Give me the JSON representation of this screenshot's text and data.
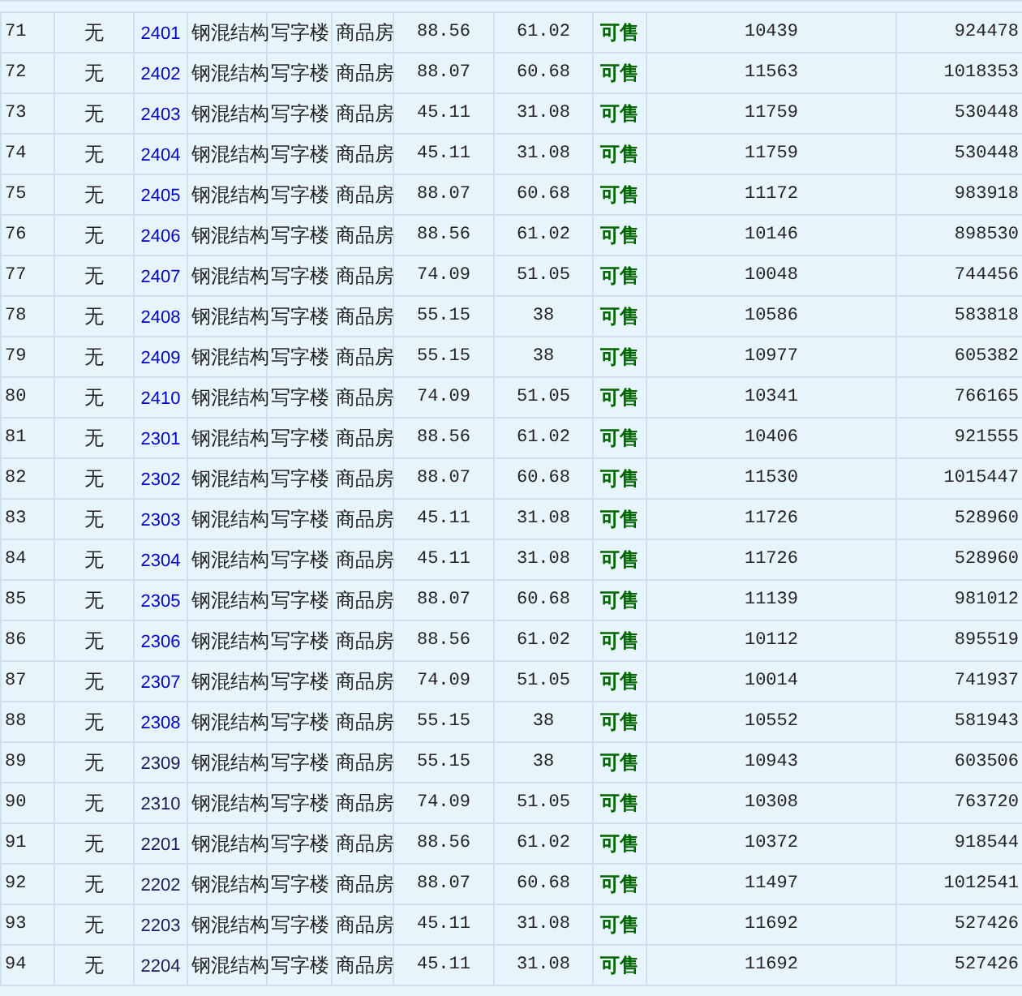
{
  "rows": [
    {
      "number": "71",
      "column_2": "无",
      "room": "2401",
      "visited": false,
      "structure": "钢混结构",
      "usage": "写字楼",
      "property_type": "商品房",
      "column_7": "88.56",
      "column_8": "61.02",
      "status": "可售",
      "column_10": "10439",
      "column_11": "924478"
    },
    {
      "number": "72",
      "column_2": "无",
      "room": "2402",
      "visited": false,
      "structure": "钢混结构",
      "usage": "写字楼",
      "property_type": "商品房",
      "column_7": "88.07",
      "column_8": "60.68",
      "status": "可售",
      "column_10": "11563",
      "column_11": "1018353"
    },
    {
      "number": "73",
      "column_2": "无",
      "room": "2403",
      "visited": false,
      "structure": "钢混结构",
      "usage": "写字楼",
      "property_type": "商品房",
      "column_7": "45.11",
      "column_8": "31.08",
      "status": "可售",
      "column_10": "11759",
      "column_11": "530448"
    },
    {
      "number": "74",
      "column_2": "无",
      "room": "2404",
      "visited": false,
      "structure": "钢混结构",
      "usage": "写字楼",
      "property_type": "商品房",
      "column_7": "45.11",
      "column_8": "31.08",
      "status": "可售",
      "column_10": "11759",
      "column_11": "530448"
    },
    {
      "number": "75",
      "column_2": "无",
      "room": "2405",
      "visited": false,
      "structure": "钢混结构",
      "usage": "写字楼",
      "property_type": "商品房",
      "column_7": "88.07",
      "column_8": "60.68",
      "status": "可售",
      "column_10": "11172",
      "column_11": "983918"
    },
    {
      "number": "76",
      "column_2": "无",
      "room": "2406",
      "visited": false,
      "structure": "钢混结构",
      "usage": "写字楼",
      "property_type": "商品房",
      "column_7": "88.56",
      "column_8": "61.02",
      "status": "可售",
      "column_10": "10146",
      "column_11": "898530"
    },
    {
      "number": "77",
      "column_2": "无",
      "room": "2407",
      "visited": false,
      "structure": "钢混结构",
      "usage": "写字楼",
      "property_type": "商品房",
      "column_7": "74.09",
      "column_8": "51.05",
      "status": "可售",
      "column_10": "10048",
      "column_11": "744456"
    },
    {
      "number": "78",
      "column_2": "无",
      "room": "2408",
      "visited": false,
      "structure": "钢混结构",
      "usage": "写字楼",
      "property_type": "商品房",
      "column_7": "55.15",
      "column_8": "38",
      "status": "可售",
      "column_10": "10586",
      "column_11": "583818"
    },
    {
      "number": "79",
      "column_2": "无",
      "room": "2409",
      "visited": false,
      "structure": "钢混结构",
      "usage": "写字楼",
      "property_type": "商品房",
      "column_7": "55.15",
      "column_8": "38",
      "status": "可售",
      "column_10": "10977",
      "column_11": "605382"
    },
    {
      "number": "80",
      "column_2": "无",
      "room": "2410",
      "visited": false,
      "structure": "钢混结构",
      "usage": "写字楼",
      "property_type": "商品房",
      "column_7": "74.09",
      "column_8": "51.05",
      "status": "可售",
      "column_10": "10341",
      "column_11": "766165"
    },
    {
      "number": "81",
      "column_2": "无",
      "room": "2301",
      "visited": false,
      "structure": "钢混结构",
      "usage": "写字楼",
      "property_type": "商品房",
      "column_7": "88.56",
      "column_8": "61.02",
      "status": "可售",
      "column_10": "10406",
      "column_11": "921555"
    },
    {
      "number": "82",
      "column_2": "无",
      "room": "2302",
      "visited": false,
      "structure": "钢混结构",
      "usage": "写字楼",
      "property_type": "商品房",
      "column_7": "88.07",
      "column_8": "60.68",
      "status": "可售",
      "column_10": "11530",
      "column_11": "1015447"
    },
    {
      "number": "83",
      "column_2": "无",
      "room": "2303",
      "visited": false,
      "structure": "钢混结构",
      "usage": "写字楼",
      "property_type": "商品房",
      "column_7": "45.11",
      "column_8": "31.08",
      "status": "可售",
      "column_10": "11726",
      "column_11": "528960"
    },
    {
      "number": "84",
      "column_2": "无",
      "room": "2304",
      "visited": false,
      "structure": "钢混结构",
      "usage": "写字楼",
      "property_type": "商品房",
      "column_7": "45.11",
      "column_8": "31.08",
      "status": "可售",
      "column_10": "11726",
      "column_11": "528960"
    },
    {
      "number": "85",
      "column_2": "无",
      "room": "2305",
      "visited": false,
      "structure": "钢混结构",
      "usage": "写字楼",
      "property_type": "商品房",
      "column_7": "88.07",
      "column_8": "60.68",
      "status": "可售",
      "column_10": "11139",
      "column_11": "981012"
    },
    {
      "number": "86",
      "column_2": "无",
      "room": "2306",
      "visited": false,
      "structure": "钢混结构",
      "usage": "写字楼",
      "property_type": "商品房",
      "column_7": "88.56",
      "column_8": "61.02",
      "status": "可售",
      "column_10": "10112",
      "column_11": "895519"
    },
    {
      "number": "87",
      "column_2": "无",
      "room": "2307",
      "visited": false,
      "structure": "钢混结构",
      "usage": "写字楼",
      "property_type": "商品房",
      "column_7": "74.09",
      "column_8": "51.05",
      "status": "可售",
      "column_10": "10014",
      "column_11": "741937"
    },
    {
      "number": "88",
      "column_2": "无",
      "room": "2308",
      "visited": false,
      "structure": "钢混结构",
      "usage": "写字楼",
      "property_type": "商品房",
      "column_7": "55.15",
      "column_8": "38",
      "status": "可售",
      "column_10": "10552",
      "column_11": "581943"
    },
    {
      "number": "89",
      "column_2": "无",
      "room": "2309",
      "visited": true,
      "structure": "钢混结构",
      "usage": "写字楼",
      "property_type": "商品房",
      "column_7": "55.15",
      "column_8": "38",
      "status": "可售",
      "column_10": "10943",
      "column_11": "603506"
    },
    {
      "number": "90",
      "column_2": "无",
      "room": "2310",
      "visited": true,
      "structure": "钢混结构",
      "usage": "写字楼",
      "property_type": "商品房",
      "column_7": "74.09",
      "column_8": "51.05",
      "status": "可售",
      "column_10": "10308",
      "column_11": "763720"
    },
    {
      "number": "91",
      "column_2": "无",
      "room": "2201",
      "visited": true,
      "structure": "钢混结构",
      "usage": "写字楼",
      "property_type": "商品房",
      "column_7": "88.56",
      "column_8": "61.02",
      "status": "可售",
      "column_10": "10372",
      "column_11": "918544"
    },
    {
      "number": "92",
      "column_2": "无",
      "room": "2202",
      "visited": true,
      "structure": "钢混结构",
      "usage": "写字楼",
      "property_type": "商品房",
      "column_7": "88.07",
      "column_8": "60.68",
      "status": "可售",
      "column_10": "11497",
      "column_11": "1012541"
    },
    {
      "number": "93",
      "column_2": "无",
      "room": "2203",
      "visited": true,
      "structure": "钢混结构",
      "usage": "写字楼",
      "property_type": "商品房",
      "column_7": "45.11",
      "column_8": "31.08",
      "status": "可售",
      "column_10": "11692",
      "column_11": "527426"
    },
    {
      "number": "94",
      "column_2": "无",
      "room": "2204",
      "visited": true,
      "structure": "钢混结构",
      "usage": "写字楼",
      "property_type": "商品房",
      "column_7": "45.11",
      "column_8": "31.08",
      "status": "可售",
      "column_10": "11692",
      "column_11": "527426"
    }
  ]
}
